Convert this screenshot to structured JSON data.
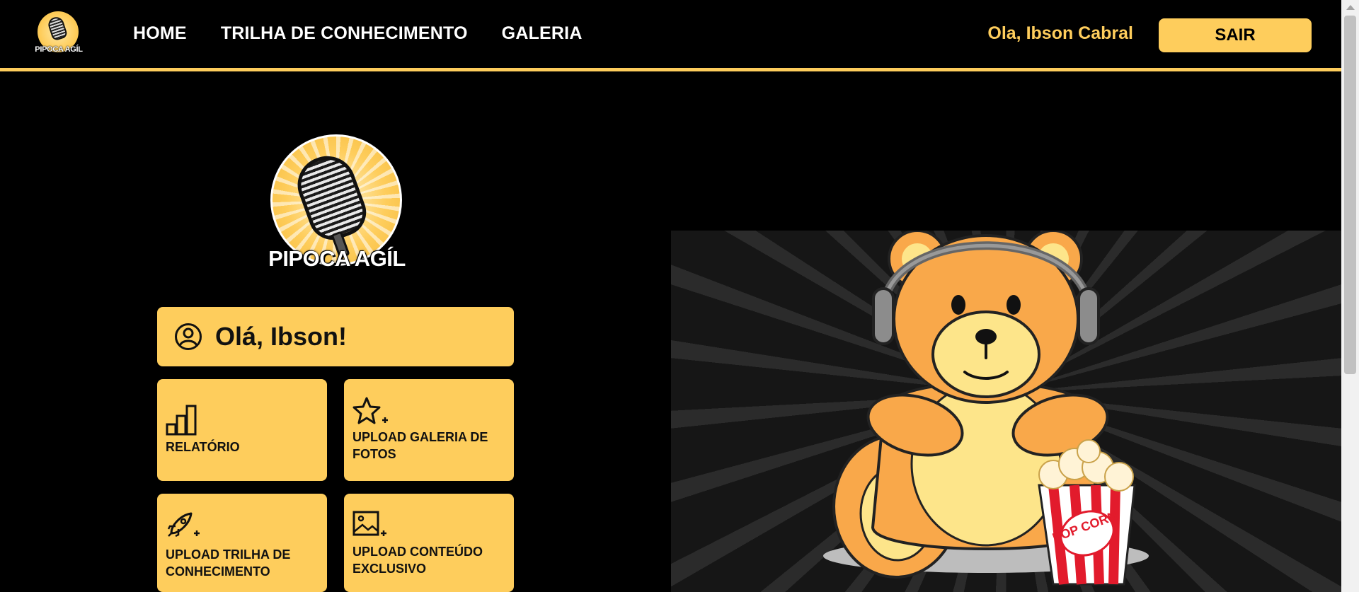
{
  "nav": {
    "logo_text": "PIPOCA AGÍL",
    "links": [
      {
        "label": "HOME"
      },
      {
        "label": "TRILHA DE CONHECIMENTO"
      },
      {
        "label": "GALERIA"
      }
    ],
    "greeting": "Ola, Ibson Cabral",
    "logout_label": "SAIR"
  },
  "hero": {
    "logo_text": "PIPOCA AGÍL"
  },
  "dashboard": {
    "hello": "Olá, Ibson!",
    "tiles": [
      {
        "label": "RELATÓRIO",
        "icon": "bar-chart-icon"
      },
      {
        "label": "UPLOAD GALERIA DE FOTOS",
        "icon": "star-plus-icon"
      },
      {
        "label": "UPLOAD TRILHA DE CONHECIMENTO",
        "icon": "rocket-plus-icon"
      },
      {
        "label": "UPLOAD CONTEÚDO EXCLUSIVO",
        "icon": "image-plus-icon"
      }
    ]
  },
  "illustration": {
    "popcorn_text": "POP CORN",
    "subject": "bear-with-headphones-and-popcorn"
  },
  "colors": {
    "accent": "#fecd5c",
    "background": "#000000",
    "text_dark": "#111111"
  }
}
